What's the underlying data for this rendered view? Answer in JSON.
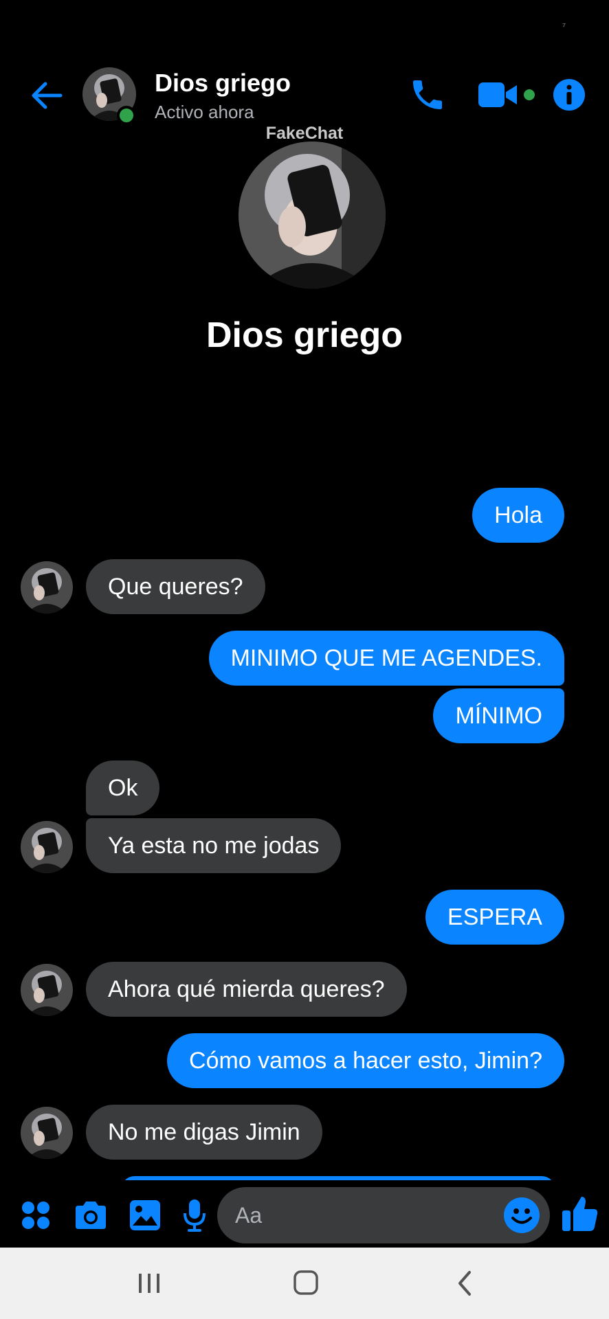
{
  "status_bar": {
    "mark": "⁷"
  },
  "header": {
    "back_icon": "arrow-left-icon",
    "contact_name": "Dios griego",
    "contact_status": "Activo ahora",
    "call_icon": "phone-icon",
    "video_icon": "video-camera-icon",
    "info_icon": "info-icon",
    "accent_color": "#0a84ff",
    "online_color": "#31a24c"
  },
  "watermark": "FakeChat",
  "profile": {
    "name": "Dios griego"
  },
  "messages": [
    {
      "dir": "out",
      "text": "Hola"
    },
    {
      "dir": "in",
      "text": "Que queres?"
    },
    {
      "dir": "out",
      "text": "MINIMO QUE ME AGENDES."
    },
    {
      "dir": "out",
      "text": "MÍNIMO"
    },
    {
      "dir": "in",
      "text": "Ok"
    },
    {
      "dir": "in",
      "text": "Ya esta no me jodas"
    },
    {
      "dir": "out",
      "text": "ESPERA"
    },
    {
      "dir": "in",
      "text": "Ahora qué mierda queres?"
    },
    {
      "dir": "out",
      "text": "Cómo vamos a hacer esto, Jimin?"
    },
    {
      "dir": "in",
      "text": "No me digas Jimin"
    }
  ],
  "composer": {
    "placeholder": "Aa",
    "icons": [
      "apps-grid-icon",
      "camera-icon",
      "gallery-icon",
      "microphone-icon",
      "emoji-icon",
      "thumbs-up-icon"
    ]
  },
  "navbar": {
    "icons": [
      "recent-apps-icon",
      "home-icon",
      "back-icon"
    ]
  }
}
